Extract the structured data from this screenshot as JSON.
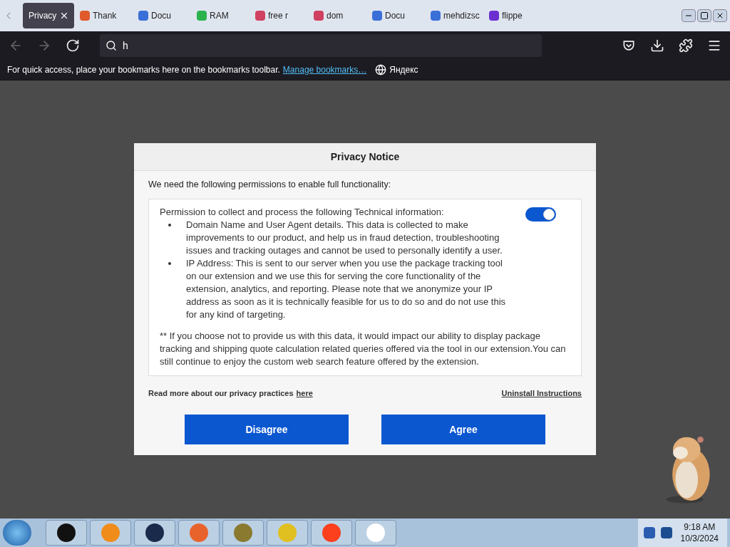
{
  "tabs": [
    {
      "title": "Privacy",
      "selected": true
    },
    {
      "title": "Thank",
      "selected": false
    },
    {
      "title": "Docu",
      "selected": false
    },
    {
      "title": "RAM",
      "selected": false
    },
    {
      "title": "free r",
      "selected": false
    },
    {
      "title": "dom",
      "selected": false
    },
    {
      "title": "Docu",
      "selected": false
    },
    {
      "title": "mehdizsc",
      "selected": false
    },
    {
      "title": "flippe",
      "selected": false
    }
  ],
  "address": {
    "value": "h"
  },
  "bookmarks_bar": {
    "message": "For quick access, place your bookmarks here on the bookmarks toolbar.",
    "link": "Manage bookmarks…",
    "bookmark": "Яндекс"
  },
  "dialog": {
    "title": "Privacy Notice",
    "intro": "We need the following permissions to enable full functionality:",
    "permission": {
      "heading": "Permission to collect and process the following Technical information:",
      "on": true,
      "bullets": [
        "Domain Name and User Agent details. This data is collected to make improvements to our product, and help us in fraud detection, troubleshooting issues and tracking outages and cannot be used to personally identify a user.",
        "IP Address: This is sent to our server when you use the package tracking tool on our extension and we use this for serving the core functionality of the extension, analytics, and reporting. Please note that we anonymize your IP address as soon as it is technically feasible for us to do so and do not use this for any kind of targeting."
      ],
      "footnote": "** If you choose not to provide us with this data, it would impact our ability to display package tracking and shipping quote calculation related queries offered via the tool in our extension.You can still continue to enjoy the custom web search feature offered by the extension."
    },
    "privacy_text": "Read more about our privacy practices",
    "privacy_link": "here",
    "uninstall_link": "Uninstall Instructions",
    "buttons": [
      "Disagree",
      "Agree"
    ]
  },
  "taskbar": {
    "time": "9:18 AM",
    "date": "10/3/2024"
  }
}
